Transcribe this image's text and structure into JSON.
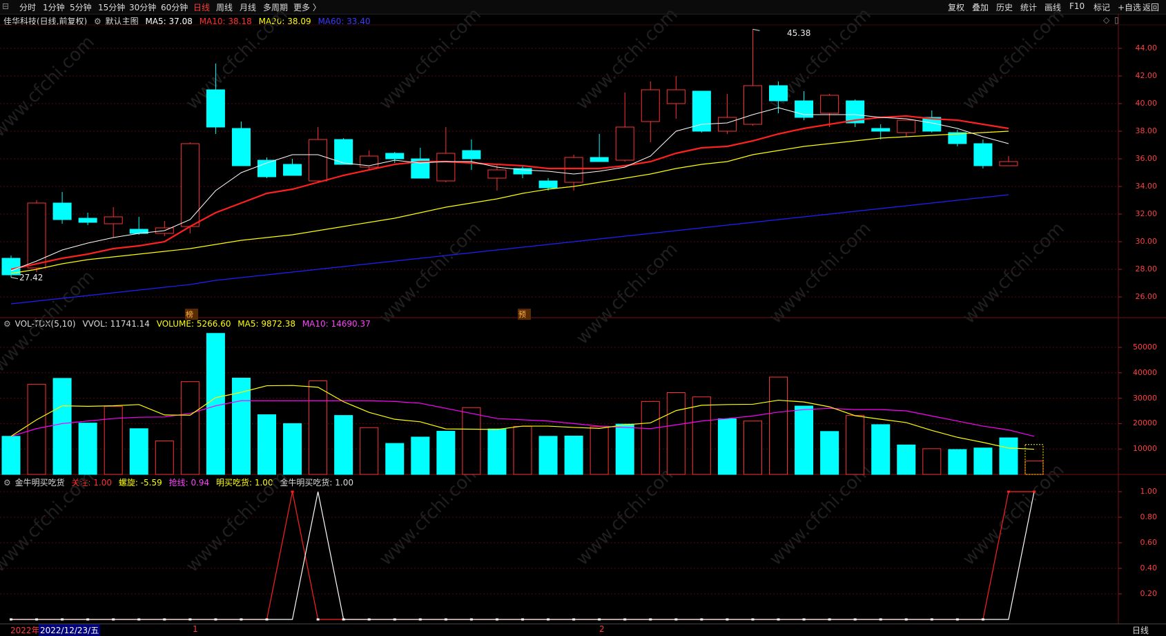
{
  "toolbar": {
    "periods": [
      "分时",
      "1分钟",
      "5分钟",
      "15分钟",
      "30分钟",
      "60分钟",
      "日线",
      "周线",
      "月线",
      "多周期",
      "更多 〉"
    ],
    "active_period": "日线",
    "right_buttons": [
      "复权",
      "叠加",
      "历史",
      "统计",
      "画线",
      "F10",
      "标记",
      "+自选",
      "返回"
    ]
  },
  "main_legend": {
    "title": "佳华科技(日线,前复权)",
    "indicator_name": "默认主图",
    "ma5": "MA5: 37.08",
    "ma10": "MA10: 38.18",
    "ma20": "MA20: 38.09",
    "ma60": "MA60: 33.40"
  },
  "vol_legend": {
    "name": "VOL-TDX(5,10)",
    "vvol": "VVOL: 11741.14",
    "volume": "VOLUME: 5266.60",
    "ma5": "MA5: 9872.38",
    "ma10": "MA10: 14690.37"
  },
  "ind_legend": {
    "name": "金牛明买吃货",
    "guanzhu": "关注: 1.00",
    "luoxuan": "螺旋: -5.59",
    "qiangxian": "抢线: 0.94",
    "mingmai": "明买吃货: 1.00",
    "jinniu": "金牛明买吃货: 1.00"
  },
  "annotations": {
    "high_label": "45.38",
    "low_label": "27.42",
    "marker_1": "榜",
    "marker_2": "预"
  },
  "price_axis": [
    "44.00",
    "42.00",
    "40.00",
    "38.00",
    "36.00",
    "34.00",
    "32.00",
    "30.00",
    "28.00",
    "26.00"
  ],
  "vol_axis": [
    "50000",
    "40000",
    "30000",
    "20000",
    "10000"
  ],
  "ind_axis": [
    "1.00",
    "0.80",
    "0.60",
    "0.40",
    "0.20"
  ],
  "bottom_bar": {
    "year_label": "2022年",
    "cursor_date": "2022/12/23/五",
    "month_1": "1",
    "month_2": "2",
    "period_label": "日线"
  },
  "watermark": "www.cfchi.com",
  "colors": {
    "up": "#ff3232",
    "down": "#00ffff",
    "ma5": "#ffffff",
    "ma10": "#ff2020",
    "ma20": "#ffff00",
    "ma60": "#2020ff",
    "vma5": "#ffff00",
    "vma10": "#ff00ff"
  },
  "chart_data": {
    "type": "candlestick",
    "candles": [
      {
        "o": 28.8,
        "h": 29.0,
        "l": 27.42,
        "c": 27.6
      },
      {
        "o": 28.1,
        "h": 33.0,
        "l": 27.8,
        "c": 32.8
      },
      {
        "o": 32.8,
        "h": 33.6,
        "l": 31.3,
        "c": 31.6
      },
      {
        "o": 31.7,
        "h": 32.1,
        "l": 31.2,
        "c": 31.4
      },
      {
        "o": 31.3,
        "h": 32.5,
        "l": 30.3,
        "c": 31.8
      },
      {
        "o": 30.9,
        "h": 31.8,
        "l": 30.5,
        "c": 30.6
      },
      {
        "o": 30.6,
        "h": 31.5,
        "l": 30.4,
        "c": 31.0
      },
      {
        "o": 31.1,
        "h": 37.2,
        "l": 30.6,
        "c": 37.1
      },
      {
        "o": 41.0,
        "h": 42.9,
        "l": 37.8,
        "c": 38.3
      },
      {
        "o": 38.2,
        "h": 38.7,
        "l": 35.5,
        "c": 35.5
      },
      {
        "o": 35.9,
        "h": 36.1,
        "l": 34.6,
        "c": 34.7
      },
      {
        "o": 35.6,
        "h": 36.0,
        "l": 34.8,
        "c": 34.8
      },
      {
        "o": 34.4,
        "h": 38.3,
        "l": 34.3,
        "c": 37.4
      },
      {
        "o": 37.4,
        "h": 37.5,
        "l": 35.6,
        "c": 35.6
      },
      {
        "o": 35.4,
        "h": 36.6,
        "l": 35.2,
        "c": 36.2
      },
      {
        "o": 36.4,
        "h": 36.5,
        "l": 35.7,
        "c": 36.0
      },
      {
        "o": 36.0,
        "h": 36.8,
        "l": 34.6,
        "c": 34.6
      },
      {
        "o": 34.4,
        "h": 38.3,
        "l": 34.3,
        "c": 36.4
      },
      {
        "o": 36.6,
        "h": 37.4,
        "l": 35.2,
        "c": 36.0
      },
      {
        "o": 34.6,
        "h": 35.6,
        "l": 33.7,
        "c": 35.2
      },
      {
        "o": 35.3,
        "h": 35.5,
        "l": 34.6,
        "c": 34.9
      },
      {
        "o": 34.4,
        "h": 34.6,
        "l": 33.7,
        "c": 33.9
      },
      {
        "o": 34.3,
        "h": 36.3,
        "l": 33.7,
        "c": 36.1
      },
      {
        "o": 36.1,
        "h": 37.8,
        "l": 35.8,
        "c": 35.8
      },
      {
        "o": 35.9,
        "h": 40.8,
        "l": 35.8,
        "c": 38.3
      },
      {
        "o": 38.7,
        "h": 41.6,
        "l": 37.2,
        "c": 41.0
      },
      {
        "o": 40.0,
        "h": 42.0,
        "l": 38.9,
        "c": 41.0
      },
      {
        "o": 40.9,
        "h": 40.9,
        "l": 37.9,
        "c": 38.0
      },
      {
        "o": 38.0,
        "h": 40.7,
        "l": 37.8,
        "c": 39.0
      },
      {
        "o": 38.5,
        "h": 45.38,
        "l": 38.4,
        "c": 41.3
      },
      {
        "o": 41.3,
        "h": 41.6,
        "l": 39.3,
        "c": 40.2
      },
      {
        "o": 40.2,
        "h": 40.9,
        "l": 38.8,
        "c": 39.0
      },
      {
        "o": 39.3,
        "h": 40.7,
        "l": 38.3,
        "c": 40.6
      },
      {
        "o": 40.2,
        "h": 40.3,
        "l": 38.3,
        "c": 38.6
      },
      {
        "o": 38.2,
        "h": 38.5,
        "l": 37.4,
        "c": 38.0
      },
      {
        "o": 37.9,
        "h": 38.8,
        "l": 37.6,
        "c": 38.8
      },
      {
        "o": 39.0,
        "h": 39.5,
        "l": 37.9,
        "c": 38.0
      },
      {
        "o": 37.9,
        "h": 38.1,
        "l": 36.9,
        "c": 37.1
      },
      {
        "o": 37.1,
        "h": 37.4,
        "l": 35.3,
        "c": 35.5
      },
      {
        "o": 35.5,
        "h": 36.2,
        "l": 35.5,
        "c": 35.8
      }
    ],
    "ma5": [
      27.9,
      28.6,
      29.4,
      29.9,
      30.3,
      30.6,
      30.8,
      31.6,
      33.7,
      35.0,
      35.7,
      36.3,
      36.3,
      35.7,
      35.5,
      35.9,
      35.7,
      35.8,
      35.8,
      35.4,
      35.2,
      35.1,
      34.9,
      35.1,
      35.4,
      36.2,
      38.0,
      38.5,
      38.6,
      39.2,
      39.7,
      39.2,
      39.2,
      39.2,
      39.0,
      38.9,
      38.6,
      38.2,
      37.6,
      37.1
    ],
    "ma10": [
      28.0,
      28.4,
      28.8,
      29.1,
      29.5,
      29.7,
      30.0,
      31.1,
      32.1,
      32.8,
      33.5,
      33.8,
      34.3,
      34.8,
      35.2,
      35.6,
      35.8,
      35.8,
      35.7,
      35.6,
      35.5,
      35.3,
      35.3,
      35.3,
      35.5,
      35.8,
      36.4,
      36.8,
      36.9,
      37.3,
      37.8,
      38.2,
      38.5,
      38.8,
      39.0,
      39.1,
      38.9,
      38.8,
      38.5,
      38.2
    ],
    "ma20": [
      27.7,
      28.0,
      28.4,
      28.7,
      28.9,
      29.1,
      29.3,
      29.5,
      29.8,
      30.1,
      30.3,
      30.5,
      30.8,
      31.1,
      31.4,
      31.7,
      32.1,
      32.5,
      32.8,
      33.1,
      33.5,
      33.8,
      34.0,
      34.3,
      34.6,
      34.9,
      35.3,
      35.6,
      35.8,
      36.3,
      36.6,
      36.9,
      37.1,
      37.3,
      37.5,
      37.6,
      37.7,
      37.8,
      37.9,
      38.0
    ],
    "ma60": [
      25.5,
      25.7,
      25.9,
      26.1,
      26.3,
      26.5,
      26.7,
      26.9,
      27.2,
      27.4,
      27.6,
      27.8,
      28.0,
      28.2,
      28.4,
      28.6,
      28.8,
      29.0,
      29.2,
      29.4,
      29.6,
      29.8,
      30.0,
      30.2,
      30.4,
      30.6,
      30.8,
      31.0,
      31.2,
      31.4,
      31.6,
      31.8,
      32.0,
      32.2,
      32.4,
      32.6,
      32.8,
      33.0,
      33.2,
      33.4
    ],
    "volume": [
      15000,
      35500,
      37800,
      20200,
      26800,
      18000,
      13200,
      36500,
      55500,
      37900,
      23500,
      20000,
      36800,
      23200,
      18400,
      12200,
      14700,
      17000,
      26300,
      17900,
      18900,
      15000,
      15100,
      18800,
      19800,
      28700,
      32200,
      30500,
      21900,
      21000,
      38300,
      26900,
      16900,
      23200,
      19600,
      11600,
      10100,
      9800,
      10400,
      14400,
      5266.6
    ],
    "vol_up": [
      false,
      true,
      false,
      false,
      true,
      false,
      true,
      true,
      false,
      false,
      false,
      false,
      true,
      false,
      true,
      false,
      false,
      false,
      true,
      false,
      true,
      false,
      false,
      true,
      false,
      true,
      true,
      true,
      false,
      true,
      true,
      false,
      false,
      true,
      false,
      false,
      true,
      false,
      false,
      false,
      true
    ],
    "vol_ma5": [
      15000,
      21500,
      27000,
      26800,
      27000,
      27500,
      23400,
      23300,
      30200,
      32300,
      34900,
      35000,
      34300,
      28600,
      24400,
      21700,
      20700,
      17900,
      17800,
      17700,
      19000,
      19000,
      18500,
      18100,
      19500,
      20300,
      25100,
      27200,
      27500,
      27600,
      29200,
      28500,
      26600,
      23100,
      21700,
      20400,
      17300,
      14600,
      12600,
      10400,
      9900
    ],
    "vol_ma10": [
      15000,
      18000,
      20000,
      21000,
      22000,
      22500,
      22600,
      24000,
      27000,
      29000,
      29000,
      29000,
      29000,
      29000,
      29000,
      28700,
      28000,
      26000,
      24000,
      22000,
      21500,
      21000,
      20000,
      19000,
      18500,
      18000,
      19500,
      21000,
      22000,
      23000,
      24500,
      25500,
      26000,
      25500,
      25500,
      25000,
      23000,
      21000,
      19000,
      17500,
      15000
    ],
    "signal_red": [
      0,
      0,
      0,
      0,
      0,
      0,
      0,
      0,
      0,
      0,
      0,
      1,
      0,
      0,
      0,
      0,
      0,
      0,
      0,
      0,
      0,
      0,
      0,
      0,
      0,
      0,
      0,
      0,
      0,
      0,
      0,
      0,
      0,
      0,
      0,
      0,
      0,
      0,
      0,
      1,
      1
    ],
    "signal_white": [
      0,
      0,
      0,
      0,
      0,
      0,
      0,
      0,
      0,
      0,
      0,
      0,
      1,
      0,
      0,
      0,
      0,
      0,
      0,
      0,
      0,
      0,
      0,
      0,
      0,
      0,
      0,
      0,
      0,
      0,
      0,
      0,
      0,
      0,
      0,
      0,
      0,
      0,
      0,
      0,
      1
    ]
  }
}
